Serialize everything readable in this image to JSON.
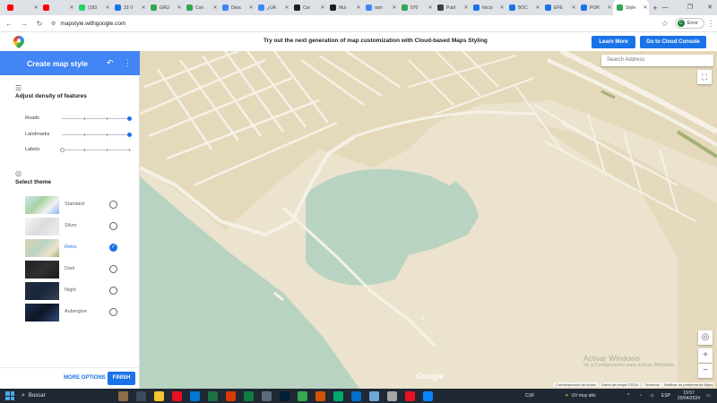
{
  "browser": {
    "tabs": [
      {
        "label": "",
        "color": "#ff0000"
      },
      {
        "label": "",
        "color": "#ff0000"
      },
      {
        "label": "(183",
        "color": "#25d366"
      },
      {
        "label": "33 V",
        "color": "#1a73e8"
      },
      {
        "label": "GRU",
        "color": "#34a853"
      },
      {
        "label": "Con",
        "color": "#34a853"
      },
      {
        "label": "Desc",
        "color": "#4285f4"
      },
      {
        "label": "¿UA",
        "color": "#4285f4"
      },
      {
        "label": "Cor",
        "color": "#1f1f1f"
      },
      {
        "label": "Mul",
        "color": "#1f1f1f"
      },
      {
        "label": "ram",
        "color": "#4285f4"
      },
      {
        "label": "570",
        "color": "#34a853"
      },
      {
        "label": "Publ",
        "color": "#3c4043"
      },
      {
        "label": "Inicio",
        "color": "#1a73e8"
      },
      {
        "label": "BOC",
        "color": "#1a73e8"
      },
      {
        "label": "EFE",
        "color": "#1a73e8"
      },
      {
        "label": "POR",
        "color": "#1a73e8"
      },
      {
        "label": "Style",
        "color": "#34a853",
        "active": true
      }
    ],
    "new_tab": "+",
    "url": "mapstyle.withgoogle.com",
    "profile_label": "Error",
    "profile_initial": "C"
  },
  "promo": {
    "message": "Try out the next generation of map customization with Cloud-based Maps Styling",
    "learn_more": "Learn More",
    "cloud_console": "Go to Cloud Console"
  },
  "sidebar": {
    "title": "Create map style",
    "density_title": "Adjust density of features",
    "sliders": [
      {
        "label": "Roads",
        "level": 1.0
      },
      {
        "label": "Landmarks",
        "level": 1.0
      },
      {
        "label": "Labels",
        "level": 0.0
      }
    ],
    "theme_title": "Select theme",
    "themes": [
      {
        "name": "Standard",
        "selected": false
      },
      {
        "name": "Silver",
        "selected": false
      },
      {
        "name": "Retro",
        "selected": true
      },
      {
        "name": "Dark",
        "selected": false
      },
      {
        "name": "Night",
        "selected": false
      },
      {
        "name": "Aubergine",
        "selected": false
      }
    ],
    "more_options": "MORE OPTIONS",
    "finish": "FINISH"
  },
  "map": {
    "search_placeholder": "Search Address",
    "google_logo": "Google",
    "attribution": [
      "Combinaciones de teclas",
      "Datos del mapa ©2024",
      "Términos",
      "Notificar un problema de Maps"
    ],
    "watermark_title": "Activar Windows",
    "watermark_sub": "Ve a Configuración para activar Windows.",
    "colors": {
      "land": "#ebe3cd",
      "water": "#b9d3c2",
      "road": "#f5f1e6",
      "park": "#a5b076"
    }
  },
  "taskbar": {
    "search": "Buscar",
    "currency": "CUF",
    "weather": "UV muy alto",
    "language": "ESP",
    "time": "19:57",
    "date": "20/04/2024"
  }
}
